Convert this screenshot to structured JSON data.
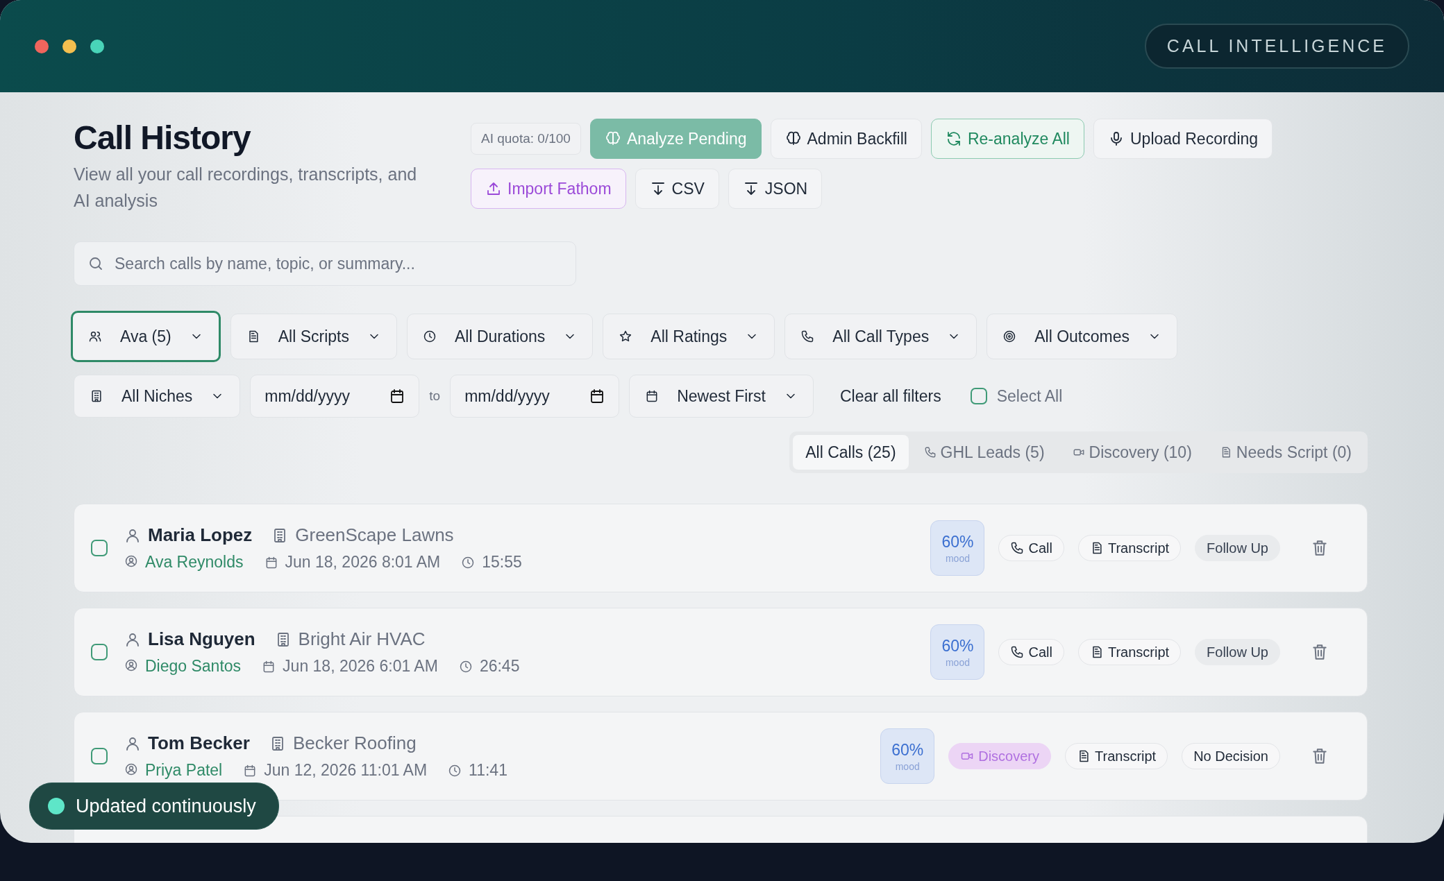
{
  "window": {
    "badge": "CALL INTELLIGENCE"
  },
  "header": {
    "title": "Call History",
    "subtitle": "View all your call recordings, transcripts, and AI analysis",
    "quota": "AI quota: 0/100"
  },
  "actions": [
    {
      "kind": "analyze",
      "label": "Analyze Pending"
    },
    {
      "kind": "backfill",
      "label": "Admin Backfill"
    },
    {
      "kind": "reanalyze",
      "label": "Re-analyze All"
    },
    {
      "kind": "upload",
      "label": "Upload Recording"
    },
    {
      "kind": "import",
      "label": "Import Fathom"
    },
    {
      "kind": "export",
      "label": "CSV"
    },
    {
      "kind": "export",
      "label": "JSON"
    }
  ],
  "search": {
    "placeholder": "Search calls by name, topic, or summary..."
  },
  "filters": [
    {
      "kind": "agent",
      "label": "Ava (5)",
      "selected": true
    },
    {
      "kind": "script",
      "label": "All Scripts",
      "selected": false
    },
    {
      "kind": "duration",
      "label": "All Durations",
      "selected": false
    },
    {
      "kind": "rating",
      "label": "All Ratings",
      "selected": false
    },
    {
      "kind": "call_type",
      "label": "All Call Types",
      "selected": false
    },
    {
      "kind": "outcome",
      "label": "All Outcomes",
      "selected": false
    }
  ],
  "filters_2": {
    "niche": "All Niches",
    "date_from": {
      "placeholder": "mm/dd/yyyy"
    },
    "date_sep": "to",
    "date_to": {
      "placeholder": "mm/dd/yyyy"
    },
    "sort": "Newest First",
    "clear": "Clear all filters",
    "select_all": {
      "label": "Select All",
      "checked": false
    }
  },
  "tabs": [
    {
      "kind": "all",
      "label": "All Calls (25)",
      "selected": true
    },
    {
      "kind": "ghl",
      "label": "GHL Leads (5)",
      "selected": false
    },
    {
      "kind": "discovery",
      "label": "Discovery (10)",
      "selected": false
    },
    {
      "kind": "script",
      "label": "Needs Script (0)",
      "selected": false
    }
  ],
  "calls": [
    {
      "name": "Maria Lopez",
      "company": "GreenScape Lawns",
      "agent": "Ava Reynolds",
      "date": "Jun 18, 2026 8:01 AM",
      "duration": "15:55",
      "mood": "60%",
      "mood_label": "mood",
      "type": {
        "kind": "call",
        "label": "Call"
      },
      "transcript": "Transcript",
      "outcome": {
        "kind": "muted",
        "label": "Follow Up"
      },
      "checked": false
    },
    {
      "name": "Lisa Nguyen",
      "company": "Bright Air HVAC",
      "agent": "Diego Santos",
      "date": "Jun 18, 2026 6:01 AM",
      "duration": "26:45",
      "mood": "60%",
      "mood_label": "mood",
      "type": {
        "kind": "call",
        "label": "Call"
      },
      "transcript": "Transcript",
      "outcome": {
        "kind": "muted",
        "label": "Follow Up"
      },
      "checked": false
    },
    {
      "name": "Tom Becker",
      "company": "Becker Roofing",
      "agent": "Priya Patel",
      "date": "Jun 12, 2026 11:01 AM",
      "duration": "11:41",
      "mood": "60%",
      "mood_label": "mood",
      "type": {
        "kind": "discovery",
        "label": "Discovery"
      },
      "transcript": "Transcript",
      "outcome": {
        "kind": "outlined",
        "label": "No Decision"
      },
      "checked": false
    }
  ],
  "toast": {
    "label": "Updated continuously"
  }
}
